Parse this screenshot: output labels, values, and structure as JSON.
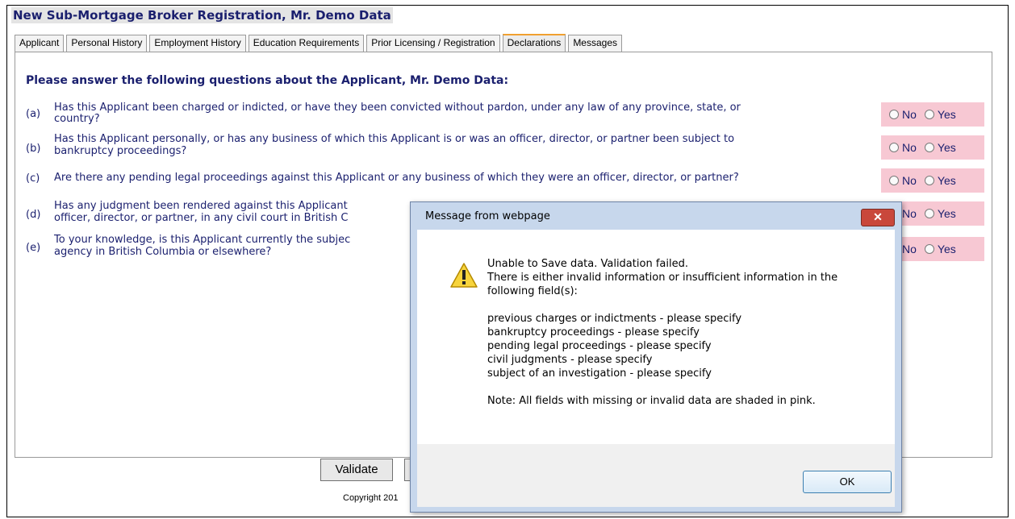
{
  "page": {
    "title": "New Sub-Mortgage Broker Registration, Mr. Demo Data",
    "tabs": [
      {
        "label": "Applicant"
      },
      {
        "label": "Personal History"
      },
      {
        "label": "Employment History"
      },
      {
        "label": "Education Requirements"
      },
      {
        "label": "Prior Licensing / Registration"
      },
      {
        "label": "Declarations",
        "active": true
      },
      {
        "label": "Messages"
      }
    ],
    "instruction": "Please answer the following questions about the Applicant, Mr. Demo Data:",
    "questions": [
      {
        "letter": "(a)",
        "line1": "Has this Applicant been charged or indicted, or have they been convicted without pardon, under any law of any province, state, or",
        "line2": "country?"
      },
      {
        "letter": "(b)",
        "line1": "Has this Applicant personally, or has any business of which this Applicant is or was an officer, director, or partner been subject to",
        "line2": "bankruptcy proceedings?"
      },
      {
        "letter": "(c)",
        "line1": "Are there any pending legal proceedings against this Applicant or any business of which they were an officer, director, or partner?",
        "line2": ""
      },
      {
        "letter": "(d)",
        "line1": "Has any judgment been rendered against this Applicant",
        "line2": "officer, director, or partner, in any civil court in British C"
      },
      {
        "letter": "(e)",
        "line1": "To your knowledge, is this Applicant currently the subjec",
        "line2": "agency in British Columbia or elsewhere?"
      }
    ],
    "answer_no": "No",
    "answer_yes": "Yes",
    "validate_label": "Validate",
    "copyright": "Copyright 201"
  },
  "dialog": {
    "title": "Message from webpage",
    "close": "✕",
    "lines": [
      "Unable to Save data. Validation failed.",
      "There is either invalid information or insufficient information in the",
      "following field(s):",
      "",
      "previous charges or indictments - please specify",
      "bankruptcy proceedings - please specify",
      "pending legal proceedings - please specify",
      "civil judgments - please specify",
      "subject of an investigation - please specify",
      "",
      "Note: All fields with missing or invalid data are shaded in pink."
    ],
    "ok_label": "OK",
    "icon": "warning-icon"
  },
  "colors": {
    "heading": "#1a1f6e",
    "invalid_shade": "#f7c8d3",
    "active_tab_accent": "#f0a030"
  }
}
